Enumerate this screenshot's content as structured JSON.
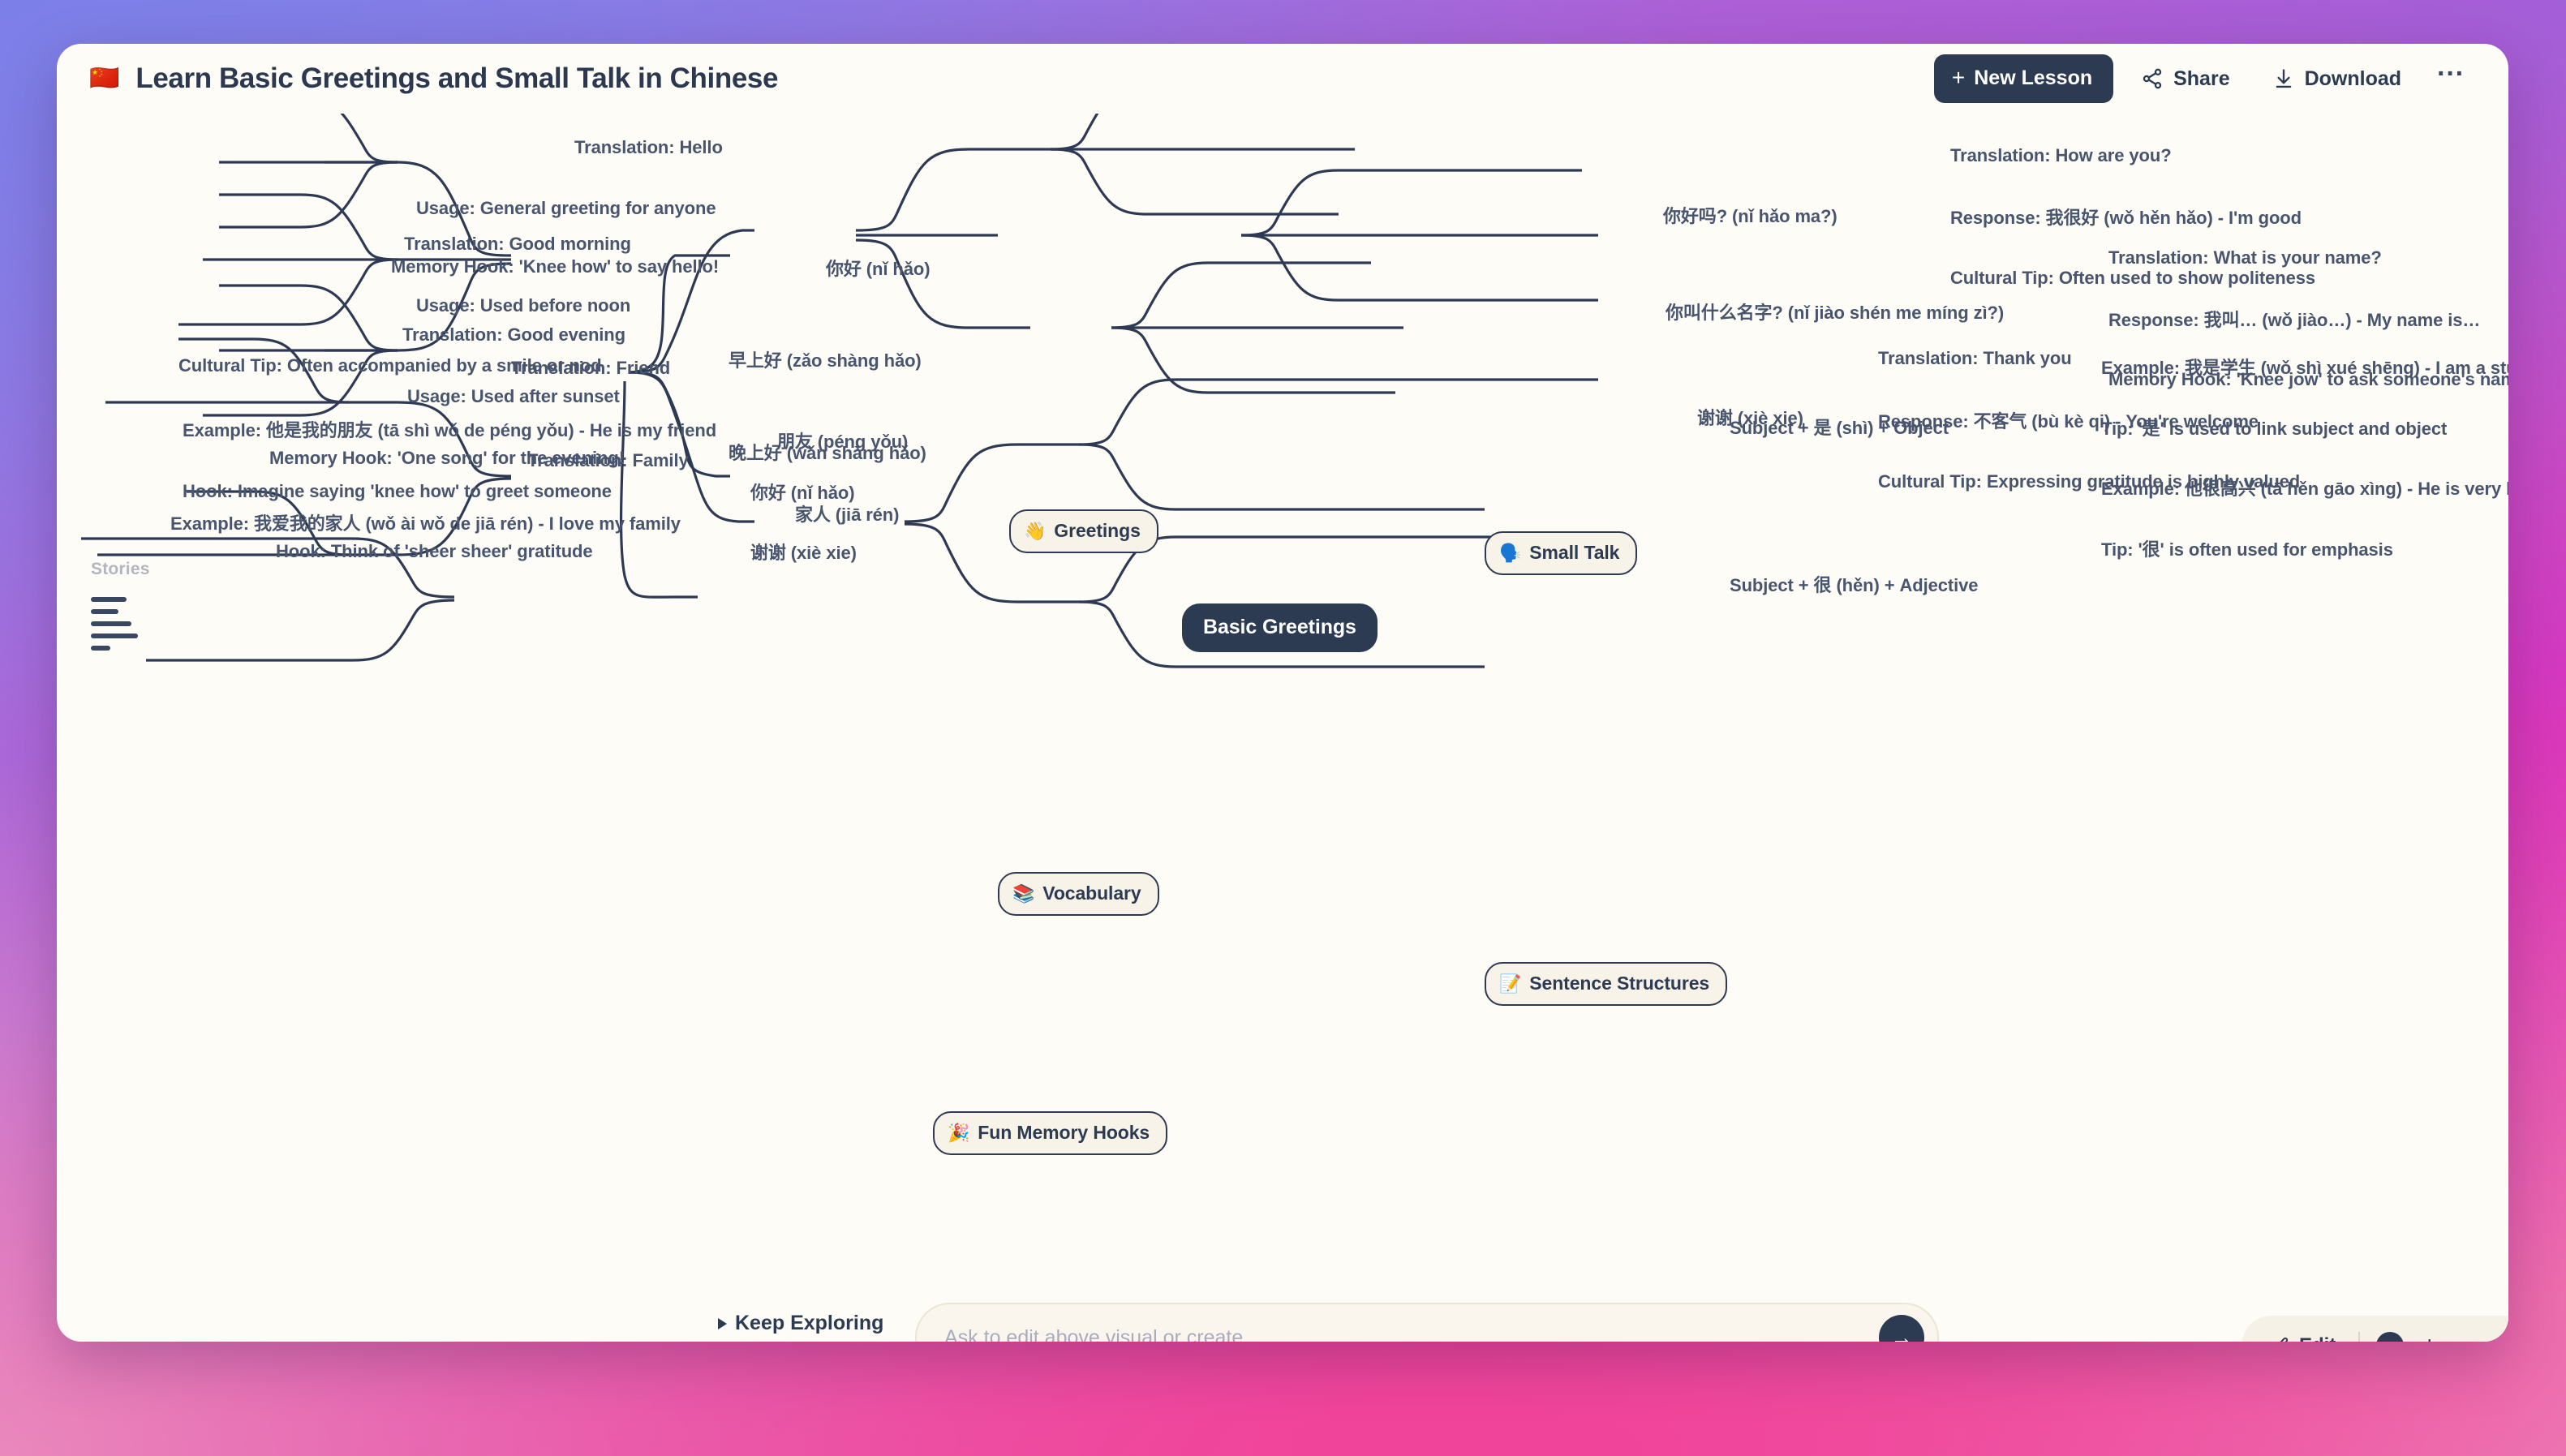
{
  "header": {
    "flag": "🇨🇳",
    "title": "Learn Basic Greetings and Small Talk in Chinese",
    "new_lesson": "New Lesson",
    "plus": "+",
    "share": "Share",
    "download": "Download",
    "more": "···"
  },
  "sidebar": {
    "stories_label": "Stories"
  },
  "root": {
    "label": "Basic Greetings"
  },
  "categories": {
    "greetings": {
      "emoji": "👋",
      "label": "Greetings"
    },
    "small_talk": {
      "emoji": "🗣️",
      "label": "Small Talk"
    },
    "vocabulary": {
      "emoji": "📚",
      "label": "Vocabulary"
    },
    "sentences": {
      "emoji": "📝",
      "label": "Sentence Structures"
    },
    "hooks": {
      "emoji": "🎉",
      "label": "Fun Memory Hooks"
    }
  },
  "phrases": {
    "ni_hao": "你好 (nǐ hǎo)",
    "zao_shang_hao": "早上好 (zǎo shàng hǎo)",
    "wan_shang_hao": "晚上好 (wǎn shàng hǎo)",
    "ni_hao_ma": "你好吗? (nǐ hǎo ma?)",
    "ni_jiao_shen_me": "你叫什么名字? (nǐ jiào shén me míng zì?)",
    "xie_xie": "谢谢 (xiè xie)",
    "peng_you": "朋友 (péng yǒu)",
    "jia_ren": "家人 (jiā rén)",
    "shi_structure": "Subject + 是 (shì) + Object",
    "hen_structure": "Subject + 很 (hěn) + Adjective",
    "hook_ni_hao": "你好 (nǐ hǎo)",
    "hook_xie_xie": "谢谢 (xiè xie)"
  },
  "details": {
    "ni_hao": [
      "Translation: Hello",
      "Usage: General greeting for anyone",
      "Memory Hook: 'Knee how' to say hello!"
    ],
    "zao_shang_hao": [
      "Translation: Good morning",
      "Usage: Used before noon",
      "Cultural Tip: Often accompanied by a smile or nod"
    ],
    "wan_shang_hao": [
      "Translation: Good evening",
      "Usage: Used after sunset",
      "Memory Hook: 'One song' for the evening!"
    ],
    "ni_hao_ma": [
      "Translation: How are you?",
      "Response: 我很好 (wǒ hěn hǎo) - I'm good",
      "Cultural Tip: Often used to show politeness"
    ],
    "ni_jiao_shen_me": [
      "Translation: What is your name?",
      "Response: 我叫… (wǒ jiào…) - My name is…",
      "Memory Hook: 'Knee jow' to ask someone's name"
    ],
    "xie_xie": [
      "Translation: Thank you",
      "Response: 不客气 (bù kè qi) - You're welcome",
      "Cultural Tip: Expressing gratitude is highly valued"
    ],
    "peng_you": [
      "Translation: Friend",
      "Example: 他是我的朋友 (tā shì wǒ de péng yǒu) - He is my friend"
    ],
    "jia_ren": [
      "Translation: Family",
      "Example: 我爱我的家人 (wǒ ài wǒ de jiā rén) - I love my family"
    ],
    "shi_structure": [
      "Example: 我是学生 (wǒ shì xué shēng) - I am a student",
      "Tip: '是' is used to link subject and object"
    ],
    "hen_structure": [
      "Example: 他很高兴 (tā hěn gāo xìng) - He is very happy",
      "Tip: '很' is often used for emphasis"
    ],
    "hook_ni_hao": [
      "Hook: Imagine saying 'knee how' to greet someone"
    ],
    "hook_xie_xie": [
      "Hook: Think of 'sheer sheer' gratitude"
    ]
  },
  "bottom": {
    "keep_exploring": "Keep Exploring",
    "prompt_placeholder": "Ask to edit above visual or create...",
    "send_arrow": "→",
    "edit": "Edit",
    "zoom_in": "+",
    "zoom_out": "−"
  }
}
